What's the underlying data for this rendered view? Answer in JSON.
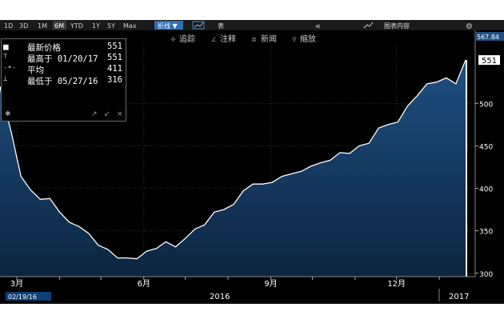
{
  "toolbar": {
    "ranges": [
      "1D",
      "3D",
      "1M",
      "6M",
      "YTD",
      "1Y",
      "5Y",
      "Max"
    ],
    "active_range": "6M",
    "chart_type_label": "折线 ▼",
    "table_label": "表",
    "collapse_label": "«",
    "content_label": "图表内容",
    "gear_label": "⚙"
  },
  "subtoolbar": {
    "track_label": "追踪",
    "annotate_label": "注释",
    "news_label": "新闻",
    "zoom_label": "缩放"
  },
  "legend": {
    "rows": [
      {
        "mark": "■",
        "label": "最新价格",
        "value": "551"
      },
      {
        "mark": "⊤",
        "label": "最高于 01/20/17",
        "value": "551"
      },
      {
        "mark": "-•-",
        "label": "平均",
        "value": "411"
      },
      {
        "mark": "⊥",
        "label": "最低于 05/27/16",
        "value": "316"
      }
    ],
    "footer_icons": [
      "✱",
      "↗",
      "↙",
      "×"
    ]
  },
  "colors": {
    "background": "#000000",
    "area_top": "#1f4f82",
    "area_bottom": "#0c2540",
    "line": "#ffffff",
    "grid": "#3a3a3a",
    "axis_text": "#ffffff",
    "toolbar_bg": "#1a1a1a",
    "active_tab": "#2d6fb4"
  },
  "chart_data": {
    "type": "area",
    "title": "",
    "xlabel": "",
    "ylabel": "",
    "ylim": [
      296,
      568
    ],
    "y_ticks": [
      300,
      350,
      400,
      450,
      500
    ],
    "y_tick_labels": [
      "300",
      "350",
      "400",
      "450",
      "500"
    ],
    "x_tick_labels": [
      "3月",
      "6月",
      "9月",
      "12月"
    ],
    "x_year_labels": [
      "2016",
      "2017"
    ],
    "start_date_label": "02/19/16",
    "last_value_label": "551",
    "top_value_label": "567.84",
    "grid": true,
    "series": [
      {
        "x": [
          "2016-02-19",
          "2016-02-26",
          "2016-03-04",
          "2016-03-11",
          "2016-03-18",
          "2016-03-25",
          "2016-04-01",
          "2016-04-08",
          "2016-04-15",
          "2016-04-22",
          "2016-04-29",
          "2016-05-06",
          "2016-05-13",
          "2016-05-20",
          "2016-05-27",
          "2016-06-03",
          "2016-06-10",
          "2016-06-17",
          "2016-06-24",
          "2016-07-01",
          "2016-07-08",
          "2016-07-15",
          "2016-07-22",
          "2016-07-29",
          "2016-08-05",
          "2016-08-12",
          "2016-08-19",
          "2016-08-26",
          "2016-09-02",
          "2016-09-09",
          "2016-09-16",
          "2016-09-23",
          "2016-09-30",
          "2016-10-07",
          "2016-10-14",
          "2016-10-21",
          "2016-10-28",
          "2016-11-04",
          "2016-11-11",
          "2016-11-18",
          "2016-11-25",
          "2016-12-02",
          "2016-12-09",
          "2016-12-16",
          "2016-12-23",
          "2016-12-30",
          "2017-01-06",
          "2017-01-13",
          "2017-01-20"
        ],
        "values": [
          510,
          466,
          414,
          398,
          387,
          388,
          372,
          360,
          355,
          347,
          333,
          328,
          318,
          318,
          317,
          326,
          329,
          337,
          331,
          341,
          352,
          357,
          372,
          375,
          381,
          397,
          405,
          405,
          407,
          414,
          417,
          420,
          426,
          430,
          433,
          442,
          441,
          450,
          453,
          471,
          475,
          478,
          497,
          509,
          523,
          525,
          530,
          523,
          551
        ]
      }
    ]
  }
}
